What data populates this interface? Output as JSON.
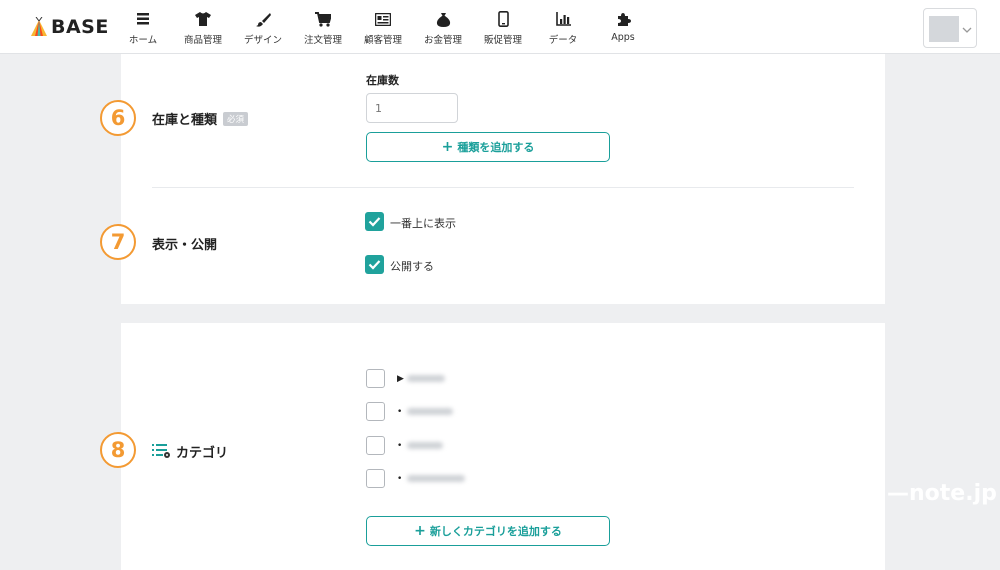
{
  "brand": {
    "name": "BASE"
  },
  "nav": [
    {
      "label": "ホーム",
      "icon": "list-icon"
    },
    {
      "label": "商品管理",
      "icon": "tshirt-icon"
    },
    {
      "label": "デザイン",
      "icon": "brush-icon"
    },
    {
      "label": "注文管理",
      "icon": "cart-icon"
    },
    {
      "label": "顧客管理",
      "icon": "contact-card-icon"
    },
    {
      "label": "お金管理",
      "icon": "money-bag-icon"
    },
    {
      "label": "販促管理",
      "icon": "smartphone-icon"
    },
    {
      "label": "データ",
      "icon": "bar-chart-icon"
    },
    {
      "label": "Apps",
      "icon": "puzzle-icon"
    }
  ],
  "stock_section": {
    "step": "6",
    "title": "在庫と種類",
    "required_badge": "必須",
    "stock_label": "在庫数",
    "stock_placeholder": "1",
    "add_variant_button": "種類を追加する"
  },
  "visibility_section": {
    "step": "7",
    "title": "表示・公開",
    "options": [
      {
        "label": "一番上に表示",
        "checked": true
      },
      {
        "label": "公開する",
        "checked": true
      }
    ]
  },
  "category_section": {
    "step": "8",
    "title": "カテゴリ",
    "categories": [
      {
        "marker": "▶",
        "checked": false
      },
      {
        "marker": "•",
        "checked": false
      },
      {
        "marker": "•",
        "checked": false
      },
      {
        "marker": "•",
        "checked": false
      }
    ],
    "add_category_button": "新しくカテゴリを追加する"
  },
  "watermark": "—note.jp",
  "colors": {
    "accent": "#1a9f9a",
    "step_orange": "#f39a33",
    "background": "#eeeff1"
  }
}
